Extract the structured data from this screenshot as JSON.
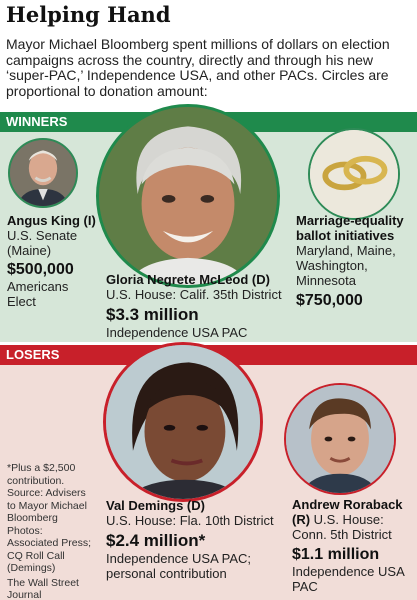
{
  "title": "Helping Hand",
  "intro": "Mayor Michael Bloomberg spent millions of dollars on election campaigns across the country, directly and through his new ‘super-PAC,’ Independence USA, and other PACs. Circles are proportional to donation amount:",
  "colors": {
    "winners": "#1f8a4c",
    "losers": "#c8202a",
    "winners_bg": "#d6e6d8",
    "losers_bg": "#f1ddd8"
  },
  "winners": {
    "label": "WINNERS",
    "king": {
      "name": "Angus King (I)",
      "race_line1": "U.S. Senate",
      "race_line2": "(Maine)",
      "amount": "$500,000",
      "source_line1": "Americans",
      "source_line2": "Elect"
    },
    "mcleod": {
      "name": "Gloria Negrete McLeod (D)",
      "race": "U.S. House: Calif. 35th District",
      "amount": "$3.3 million",
      "source": "Independence USA PAC"
    },
    "marriage": {
      "name_line1": "Marriage-equality",
      "name_line2": "ballot initiatives",
      "states_line1": "Maryland, Maine,",
      "states_line2": "Washington,",
      "states_line3": "Minnesota",
      "amount": "$750,000"
    }
  },
  "losers": {
    "label": "LOSERS",
    "demings": {
      "name": "Val Demings (D)",
      "race": "U.S. House: Fla. 10th District",
      "amount": "$2.4 million*",
      "source_line1": "Independence USA PAC;",
      "source_line2": "personal contribution"
    },
    "roraback": {
      "name_line1": "Andrew Roraback",
      "name_line2_bold": "(R)",
      "name_line2_rest": " U.S. House:",
      "race_line2": "Conn. 5th District",
      "amount": "$1.1 million",
      "source_line1": "Independence USA",
      "source_line2": "PAC"
    }
  },
  "notes": {
    "footnote_lines": [
      "*Plus a $2,500",
      "contribution."
    ],
    "source_lines": [
      "Source: Advisers",
      "to Mayor Michael",
      "Bloomberg"
    ],
    "photos_lines": [
      "Photos:",
      "Associated Press;",
      "CQ Roll Call",
      "(Demings)"
    ],
    "publisher_lines": [
      "The Wall Street",
      "Journal"
    ]
  }
}
